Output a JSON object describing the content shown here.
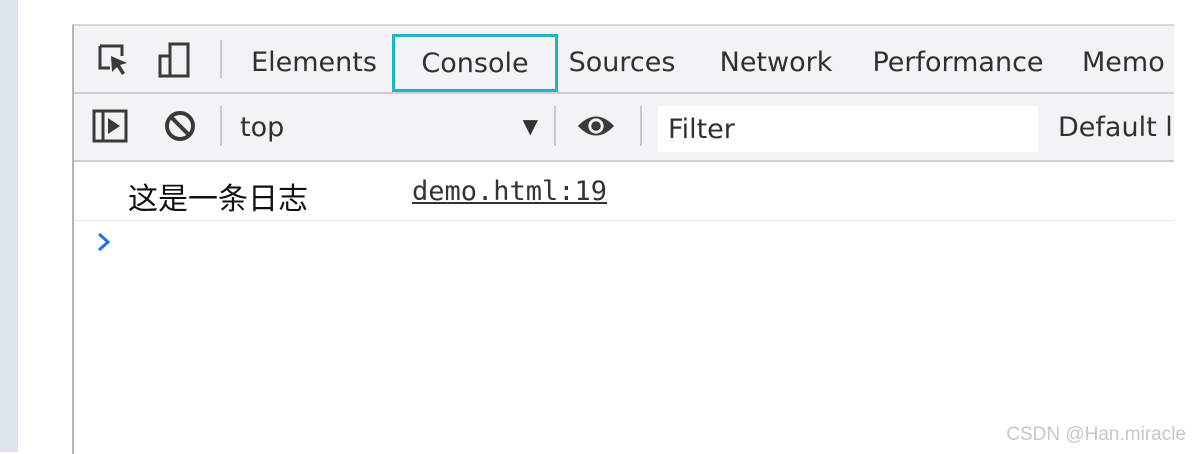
{
  "tabs": [
    {
      "label": "Elements",
      "selected": false
    },
    {
      "label": "Console",
      "selected": true
    },
    {
      "label": "Sources",
      "selected": false
    },
    {
      "label": "Network",
      "selected": false
    },
    {
      "label": "Performance",
      "selected": false
    },
    {
      "label": "Memo",
      "selected": false
    }
  ],
  "icons": {
    "inspect": "inspect-element-icon",
    "device": "device-toolbar-icon",
    "sidebar": "show-console-sidebar-icon",
    "clear": "clear-console-icon",
    "eye": "live-expression-eye-icon",
    "dropdown": "dropdown-arrow-icon",
    "prompt": "console-prompt-chevron-icon"
  },
  "toolbar": {
    "context": "top",
    "dropdown_glyph": "▼",
    "filter_placeholder": "Filter",
    "levels_label": "Default le"
  },
  "console": {
    "messages": [
      {
        "text": "这是一条日志",
        "source": "demo.html:19"
      }
    ]
  },
  "watermark": "CSDN @Han.miracle",
  "colors": {
    "selected_tab_border": "#19b7c6",
    "prompt": "#1a73e8",
    "toolbar_bg": "#f1f3f4"
  }
}
